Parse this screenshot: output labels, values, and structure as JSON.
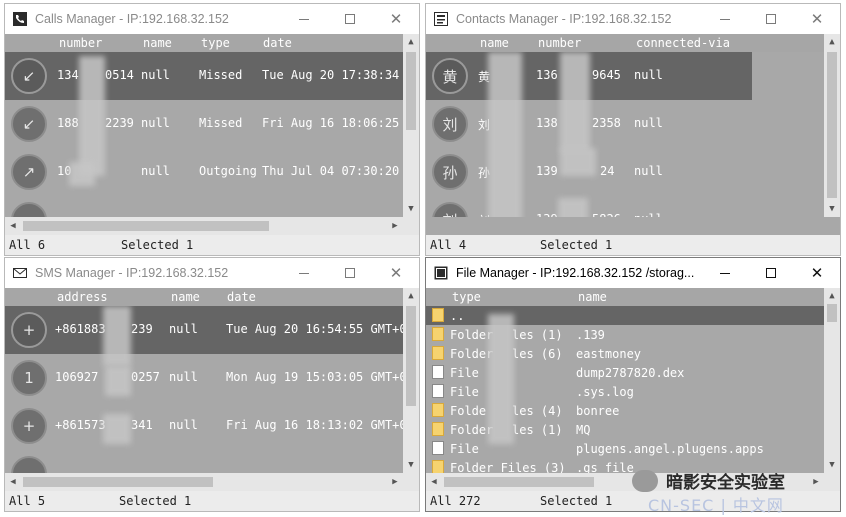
{
  "calls": {
    "title": "Calls Manager - IP:192.168.32.152",
    "columns": [
      "number",
      "name",
      "type",
      "date"
    ],
    "rows": [
      {
        "avatar": "↙",
        "number": "134",
        "number_end": "0514",
        "name": "null",
        "type": "Missed",
        "date": "Tue Aug 20 17:38:34"
      },
      {
        "avatar": "↙",
        "number": "188",
        "number_end": "2239",
        "name": "null",
        "type": "Missed",
        "date": "Fri Aug 16 18:06:25"
      },
      {
        "avatar": "↗",
        "number": "10",
        "number_end": "",
        "name": "null",
        "type": "Outgoing",
        "date": "Thu Jul 04 07:30:20"
      }
    ],
    "status_all": "All 6",
    "status_selected": "Selected 1"
  },
  "contacts": {
    "title": "Contacts Manager - IP:192.168.32.152",
    "columns": [
      "name",
      "number",
      "connected-via"
    ],
    "rows": [
      {
        "avatar": "黄",
        "name": "黄",
        "number": "136",
        "number_end": "9645",
        "via": "null"
      },
      {
        "avatar": "刘",
        "name": "刘",
        "number": "138",
        "number_end": "2358",
        "via": "null"
      },
      {
        "avatar": "孙",
        "name": "孙",
        "number": "139",
        "number_end": "24",
        "via": "null"
      },
      {
        "avatar": "刘",
        "name": "刘",
        "number": "139",
        "number_end": "5826",
        "via": "null"
      }
    ],
    "status_all": "All 4",
    "status_selected": "Selected 1"
  },
  "sms": {
    "title": "SMS Manager - IP:192.168.32.152",
    "columns": [
      "address",
      "name",
      "date"
    ],
    "rows": [
      {
        "avatar": "+",
        "address": "+861883",
        "address_end": "239",
        "name": "null",
        "date": "Tue Aug 20 16:54:55 GMT+0"
      },
      {
        "avatar": "1",
        "address": "106927",
        "address_end": "0257",
        "name": "null",
        "date": "Mon Aug 19 15:03:05 GMT+0"
      },
      {
        "avatar": "+",
        "address": "+861573",
        "address_end": "341",
        "name": "null",
        "date": "Fri Aug 16 18:13:02 GMT+0"
      }
    ],
    "status_all": "All 5",
    "status_selected": "Selected 1"
  },
  "files": {
    "title": "File Manager - IP:192.168.32.152 /storag...",
    "columns": [
      "type",
      "name"
    ],
    "rows": [
      {
        "kind": "folder",
        "type": "..",
        "name": ""
      },
      {
        "kind": "folder",
        "type": "Folder",
        "type_end": "les (1)",
        "name": ".139"
      },
      {
        "kind": "folder",
        "type": "Folder",
        "type_end": "les (6)",
        "name": "eastmoney"
      },
      {
        "kind": "file",
        "type": "File",
        "type_end": "",
        "name": "dump2787820.dex"
      },
      {
        "kind": "file",
        "type": "File",
        "type_end": "",
        "name": ".sys.log"
      },
      {
        "kind": "folder",
        "type": "Folde",
        "type_end": "les (4)",
        "name": "bonree"
      },
      {
        "kind": "folder",
        "type": "Folder",
        "type_end": "les (1)",
        "name": "MQ"
      },
      {
        "kind": "file",
        "type": "File",
        "type_end": "",
        "name": "plugens.angel.plugens.apps"
      },
      {
        "kind": "folder",
        "type": "Folder Files (3)",
        "type_end": "",
        "name": ".gs_file"
      }
    ],
    "status_all": "All 272",
    "status_selected": "Selected 1"
  },
  "watermark": {
    "text": "暗影安全实验室",
    "sub": "CN-SEC | 中文网"
  },
  "colors": {
    "panel_bg": "#a8a8a8",
    "selected_row": "#656565",
    "status_bg": "#ececec"
  }
}
